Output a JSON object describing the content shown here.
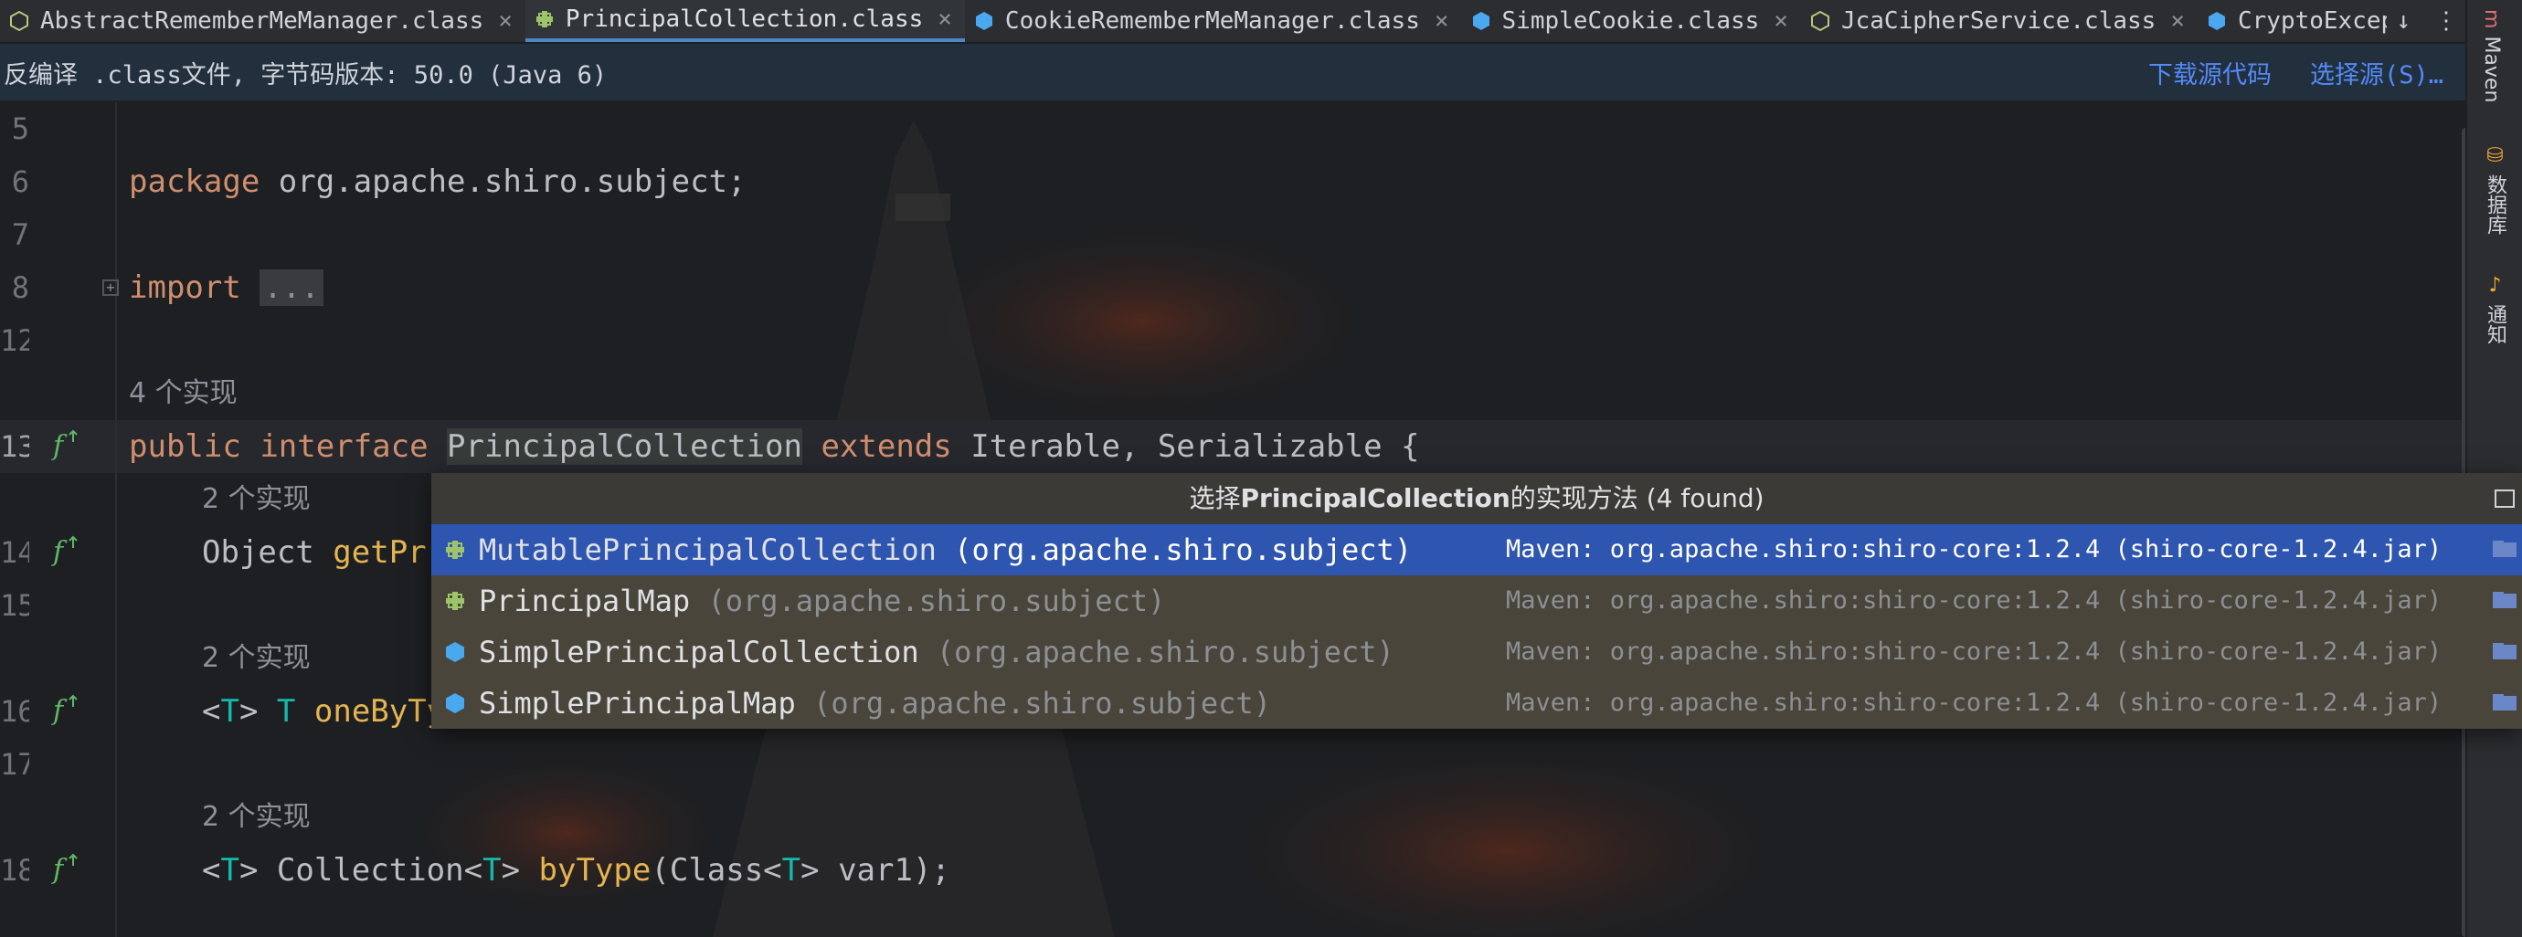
{
  "tabs": [
    {
      "label": "AbstractRememberMeManager.class",
      "icon": "abstract-class-icon",
      "active": false
    },
    {
      "label": "PrincipalCollection.class",
      "icon": "interface-icon",
      "active": true
    },
    {
      "label": "CookieRememberMeManager.class",
      "icon": "class-icon",
      "active": false
    },
    {
      "label": "SimpleCookie.class",
      "icon": "class-icon",
      "active": false
    },
    {
      "label": "JcaCipherService.class",
      "icon": "abstract-class-icon",
      "active": false
    },
    {
      "label": "CryptoException.clas",
      "icon": "class-icon",
      "active": false
    }
  ],
  "tab_close_glyph": "×",
  "notice": {
    "text": "反编译 .class文件, 字节码版本: 50.0 (Java 6)",
    "download_source": "下载源代码",
    "choose_source": "选择源(S)…"
  },
  "right_tools": {
    "maven": "Maven",
    "database": "数据库",
    "notifications": "通知"
  },
  "editor": {
    "line_numbers": [
      "5",
      "6",
      "7",
      "8",
      "12",
      "",
      "13",
      "",
      "14",
      "15",
      "",
      "16",
      "17",
      "",
      "18",
      ""
    ],
    "code": {
      "l6_kw": "package",
      "l6_rest": " org.apache.shiro.subject;",
      "l8_kw": "import",
      "l8_folded": "...",
      "hint_4": "4 个实现",
      "l13_public": "public",
      "l13_interface": "interface",
      "l13_name": "PrincipalCollection",
      "l13_extends": "extends",
      "l13_rest": " Iterable, Serializable {",
      "hint_2a": "2 个实现",
      "l14_type": "Object ",
      "l14_fn": "getPr",
      "hint_2b": "2 个实现",
      "l16_t1": "<",
      "l16_T": "T",
      "l16_t2": "> ",
      "l16_T2": "T",
      "l16_fn": " oneByTy",
      "hint_2c": "2 个实现",
      "l18_a": "<",
      "l18_T": "T",
      "l18_b": "> Collection<",
      "l18_T2": "T",
      "l18_c": "> ",
      "l18_fn": "byType",
      "l18_d": "(Class<",
      "l18_T3": "T",
      "l18_e": "> var1);"
    }
  },
  "popup": {
    "title_prefix": "选择",
    "title_name": "PrincipalCollection",
    "title_suffix": "的实现方法 (4 found)",
    "items": [
      {
        "name": "MutablePrincipalCollection",
        "package": " (org.apache.shiro.subject)",
        "location": "Maven: org.apache.shiro:shiro-core:1.2.4 (shiro-core-1.2.4.jar)",
        "icon": "interface-icon",
        "selected": true
      },
      {
        "name": "PrincipalMap",
        "package": " (org.apache.shiro.subject)",
        "location": "Maven: org.apache.shiro:shiro-core:1.2.4 (shiro-core-1.2.4.jar)",
        "icon": "interface-icon",
        "selected": false
      },
      {
        "name": "SimplePrincipalCollection",
        "package": " (org.apache.shiro.subject)",
        "location": "Maven: org.apache.shiro:shiro-core:1.2.4 (shiro-core-1.2.4.jar)",
        "icon": "class-icon",
        "selected": false
      },
      {
        "name": "SimplePrincipalMap",
        "package": " (org.apache.shiro.subject)",
        "location": "Maven: org.apache.shiro:shiro-core:1.2.4 (shiro-core-1.2.4.jar)",
        "icon": "class-icon",
        "selected": false
      }
    ]
  },
  "colors": {
    "keyword": "#cf8e6d",
    "method": "#e6b450",
    "type_param": "#16baac",
    "selection": "#2e55b0",
    "link": "#548af7"
  }
}
